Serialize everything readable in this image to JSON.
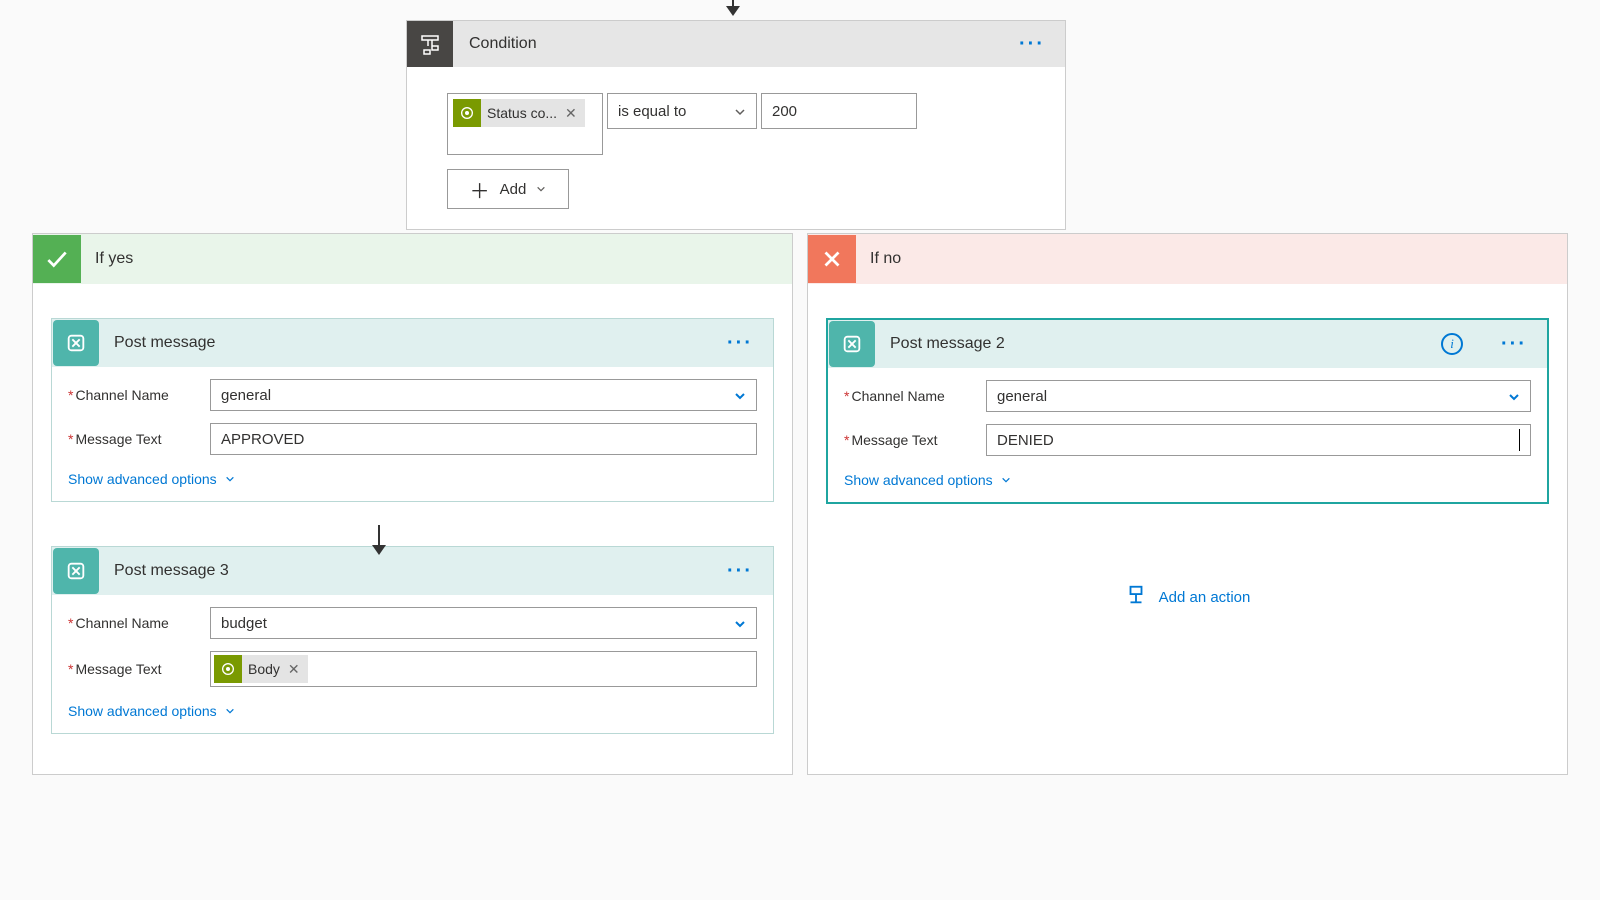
{
  "condition": {
    "title": "Condition",
    "token_label": "Status co...",
    "operator": "is equal to",
    "value": "200",
    "add_label": "Add"
  },
  "branches": {
    "yes_label": "If yes",
    "no_label": "If no"
  },
  "labels": {
    "channel_name": "Channel Name",
    "message_text": "Message Text",
    "show_advanced": "Show advanced options",
    "add_action": "Add an action"
  },
  "post_message_1": {
    "title": "Post message",
    "channel": "general",
    "text": "APPROVED"
  },
  "post_message_3": {
    "title": "Post message 3",
    "channel": "budget",
    "token_label": "Body"
  },
  "post_message_2": {
    "title": "Post message 2",
    "channel": "general",
    "text": "DENIED"
  }
}
